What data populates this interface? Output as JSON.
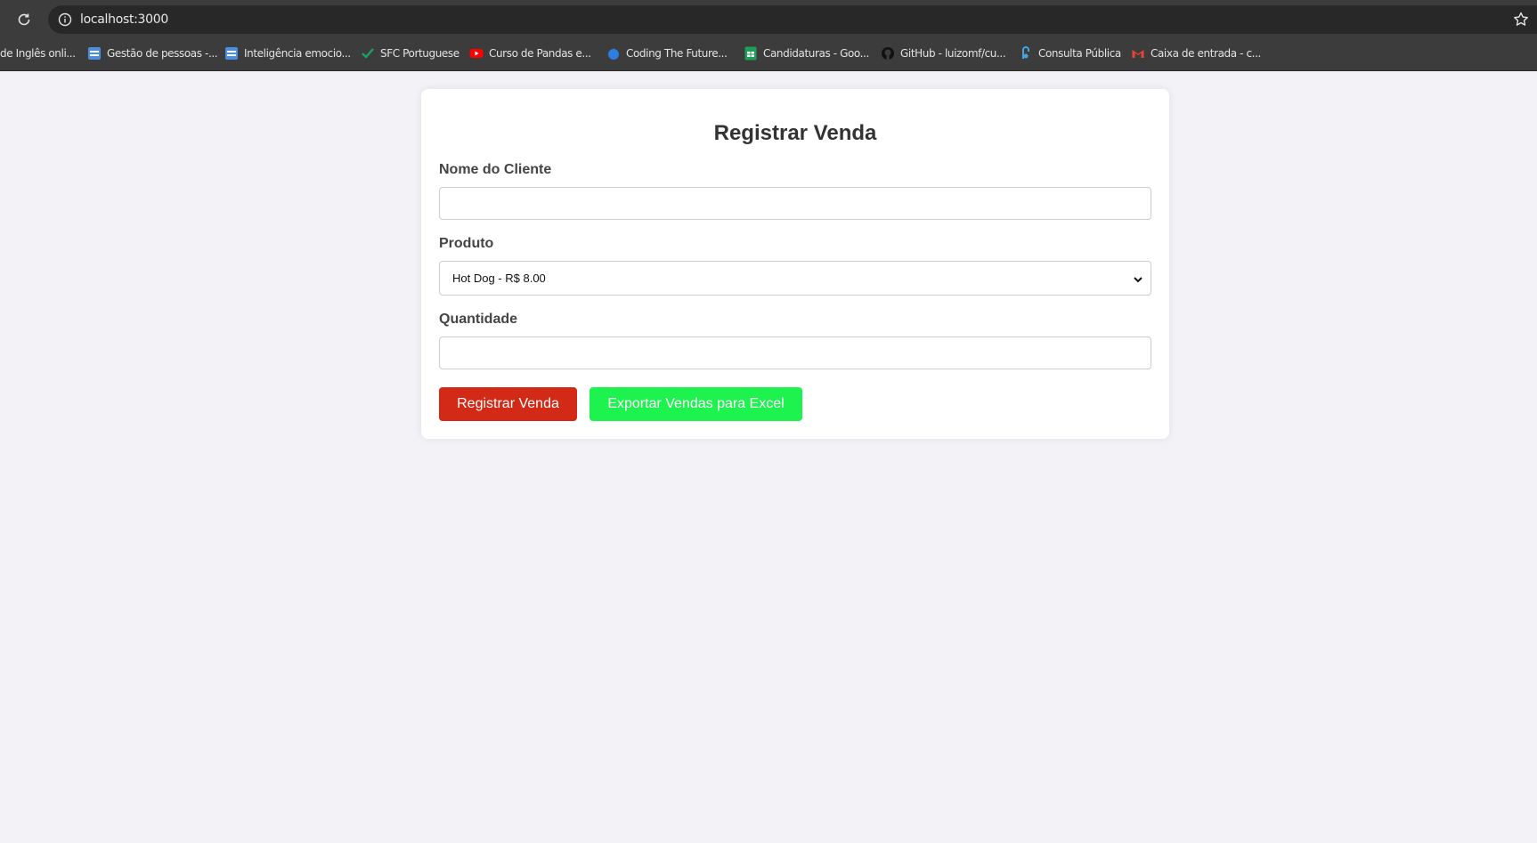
{
  "browser": {
    "url": "localhost:3000",
    "bookmarks": [
      {
        "label": "de Inglês onli...",
        "icon": "none"
      },
      {
        "label": "Gestão de pessoas -...",
        "icon": "doc-icon",
        "color": "#4a90e2"
      },
      {
        "label": "Inteligência emocio...",
        "icon": "doc-icon",
        "color": "#4a90e2"
      },
      {
        "label": "SFC Portuguese",
        "icon": "check-icon",
        "color": "#1aa260"
      },
      {
        "label": "Curso de Pandas e...",
        "icon": "youtube-icon",
        "color": "#ff0000"
      },
      {
        "label": "Coding The Future...",
        "icon": "drop-icon",
        "color": "#2f7de1"
      },
      {
        "label": "Candidaturas - Goo...",
        "icon": "sheets-icon",
        "color": "#1e9e56"
      },
      {
        "label": "GitHub - luizomf/cu...",
        "icon": "github-icon",
        "color": "#111111"
      },
      {
        "label": "Consulta Pública",
        "icon": "consulta-icon",
        "color": "#4aa3df"
      },
      {
        "label": "Caixa de entrada - c...",
        "icon": "gmail-icon",
        "color": "#ea4335"
      }
    ]
  },
  "form": {
    "title": "Registrar Venda",
    "client_label": "Nome do Cliente",
    "client_value": "",
    "product_label": "Produto",
    "product_selected": "Hot Dog - R$ 8.00",
    "quantity_label": "Quantidade",
    "quantity_value": "",
    "submit_label": "Registrar Venda",
    "export_label": "Exportar Vendas para Excel"
  },
  "colors": {
    "submit_button": "#d32a18",
    "export_button": "#1ef24f",
    "background": "#f3f3f7"
  }
}
